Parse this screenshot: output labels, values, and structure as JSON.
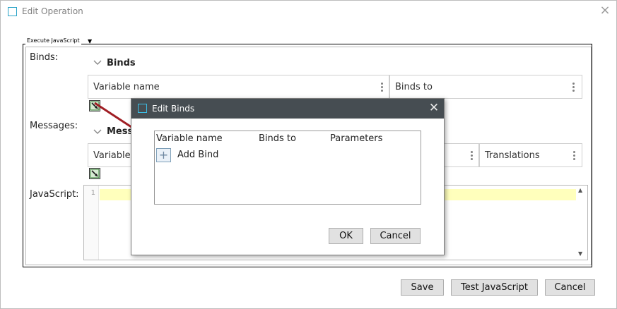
{
  "window": {
    "title": "Edit Operation",
    "close_icon": "×"
  },
  "group": {
    "legend": "Execute JavaScript",
    "legend_arrow": "▼"
  },
  "binds": {
    "label": "Binds:",
    "section_title": "Binds",
    "columns": [
      "Variable name",
      "Binds to"
    ]
  },
  "messages": {
    "label": "Messages:",
    "section_title": "Messages",
    "columns": [
      "Variable name",
      "Translations"
    ]
  },
  "javascript": {
    "label": "JavaScript:",
    "line_numbers": [
      "1"
    ],
    "scroll_up": "▲",
    "scroll_down": "▼"
  },
  "footer": {
    "save": "Save",
    "test": "Test JavaScript",
    "cancel": "Cancel"
  },
  "modal": {
    "title": "Edit Binds",
    "close_icon": "✕",
    "columns": [
      "Variable name",
      "Binds to",
      "Parameters"
    ],
    "add_bind_label": "Add Bind",
    "add_icon": "+",
    "ok": "OK",
    "cancel": "Cancel"
  },
  "colors": {
    "accent": "#29a3c7",
    "modal_title_bg": "#464d52",
    "arrow": "#a01e24",
    "highlight_line": "#ffffbc"
  }
}
